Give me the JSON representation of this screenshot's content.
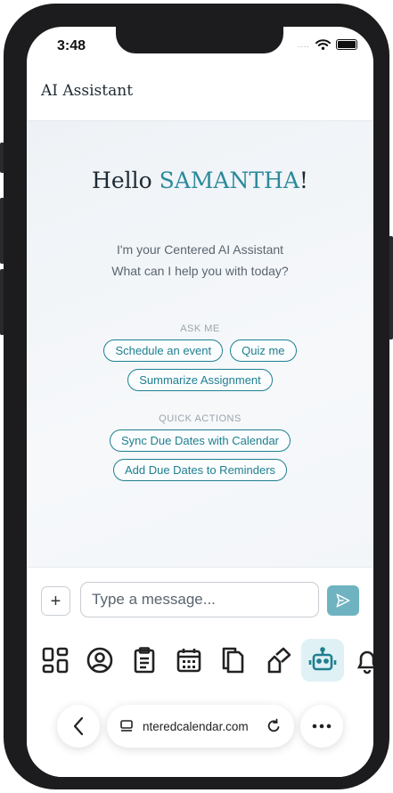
{
  "status_bar": {
    "time": "3:48",
    "signal": "....",
    "wifi_icon": "wifi-icon",
    "battery_icon": "battery-icon"
  },
  "header": {
    "title": "AI Assistant"
  },
  "chat": {
    "greeting_prefix": "Hello ",
    "user_name": "SAMANTHA",
    "greeting_suffix": "!",
    "intro_line1": "I'm your Centered AI Assistant",
    "intro_line2": "What can I help you with today?",
    "ask_me_label": "ASK ME",
    "ask_me_chips": [
      "Schedule an event",
      "Quiz me",
      "Summarize Assignment"
    ],
    "quick_actions_label": "QUICK ACTIONS",
    "quick_action_chips": [
      "Sync Due Dates with Calendar",
      "Add Due Dates to Reminders"
    ]
  },
  "composer": {
    "plus_label": "+",
    "input_placeholder": "Type a message...",
    "input_value": "",
    "send_icon": "send-icon"
  },
  "tabbar": {
    "tabs": [
      {
        "icon": "dashboard-icon",
        "active": false
      },
      {
        "icon": "profile-icon",
        "active": false
      },
      {
        "icon": "clipboard-icon",
        "active": false
      },
      {
        "icon": "calendar-icon",
        "active": false
      },
      {
        "icon": "copy-icon",
        "active": false
      },
      {
        "icon": "pen-icon",
        "active": false
      },
      {
        "icon": "robot-icon",
        "active": true
      },
      {
        "icon": "bell-icon",
        "active": false
      }
    ]
  },
  "browser": {
    "back_icon": "back-icon",
    "url": "nteredcalendar.com",
    "tabs_icon": "tabs-icon",
    "reload_icon": "reload-icon",
    "more_icon": "more-icon"
  },
  "colors": {
    "accent": "#1f7f90",
    "name_color": "#2a8a9a",
    "send_button": "#6fb3c0",
    "active_tab_bg": "#dff1f5"
  }
}
